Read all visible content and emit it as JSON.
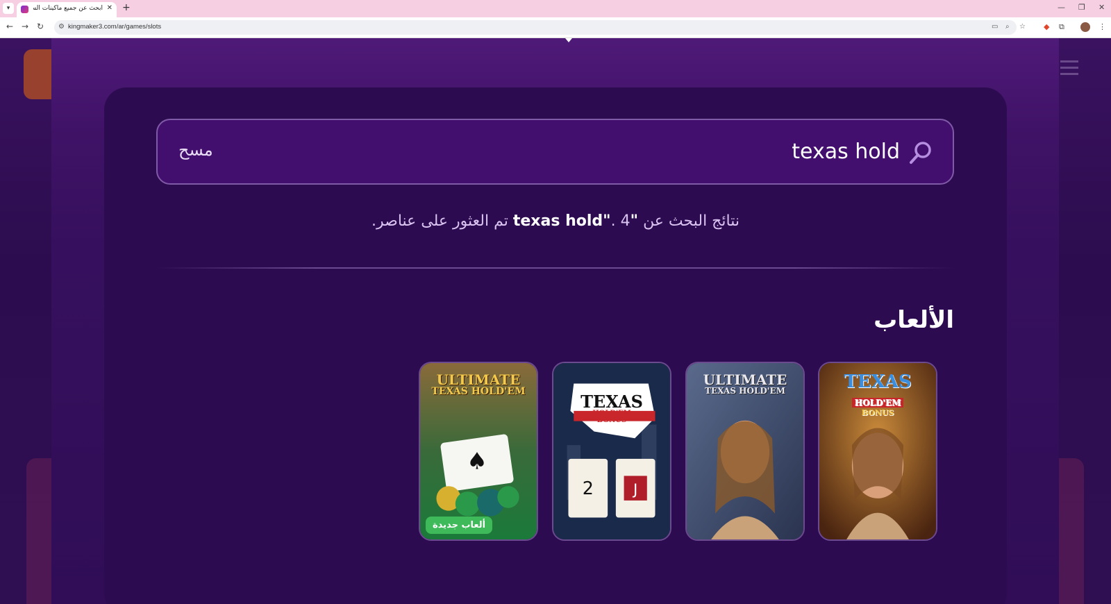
{
  "browser": {
    "tab_title": "ابحث عن جميع ماكينات السلوتس",
    "url": "kingmaker3.com/ar/games/slots"
  },
  "search": {
    "query": "texas hold",
    "clear_label": "مسح",
    "results_prefix": "نتائج البحث عن",
    "results_query": "\"texas hold\"",
    "results_suffix": ". 4 تم العثور على عناصر."
  },
  "games_section": {
    "title": "الألعاب",
    "games": [
      {
        "logo_line1": "TEXAS",
        "logo_line2": "HOLD'EM",
        "logo_line3": "BONUS",
        "badge": ""
      },
      {
        "logo_line1": "ULTIMATE",
        "logo_line2": "TEXAS HOLD'EM",
        "logo_line3": "",
        "badge": ""
      },
      {
        "logo_line1": "TEXAS",
        "logo_line2": "HOLD'EM",
        "logo_line3": "BONUS",
        "badge": ""
      },
      {
        "logo_line1": "ULTIMATE",
        "logo_line2": "TEXAS HOLD'EM",
        "logo_line3": "",
        "badge": "ألعاب جديدة"
      }
    ]
  },
  "colors": {
    "accent": "#430f6e",
    "badge": "#3fba5a"
  }
}
